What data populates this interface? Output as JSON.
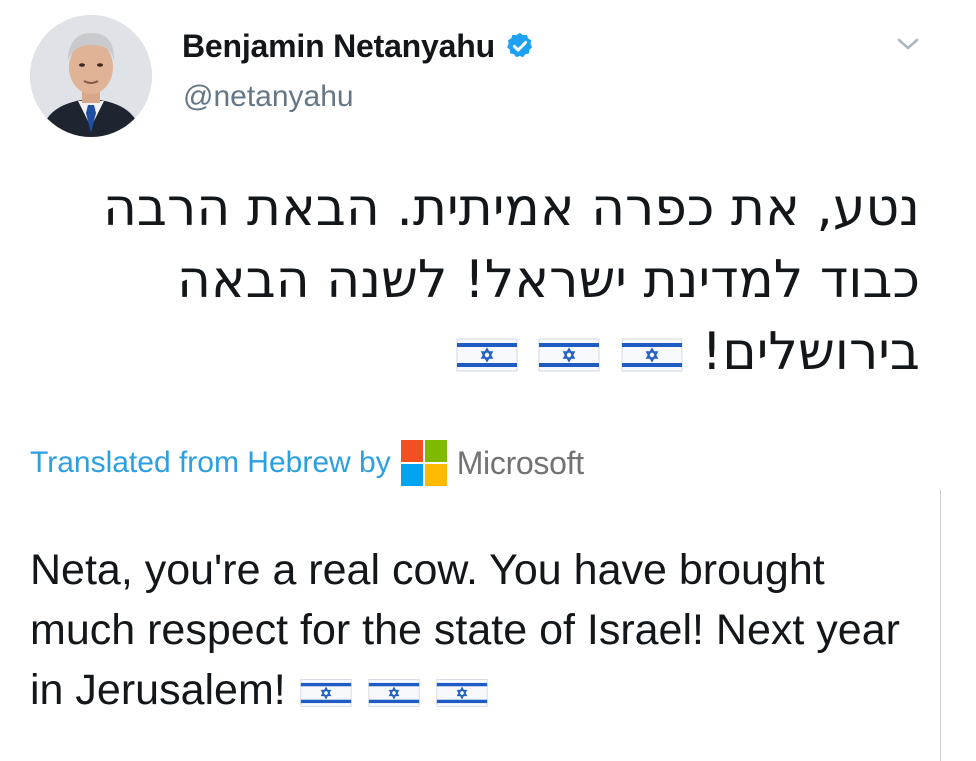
{
  "tweet": {
    "author": {
      "display_name": "Benjamin Netanyahu",
      "handle": "@netanyahu",
      "verified": true,
      "avatar_icon": "profile-photo"
    },
    "menu_icon": "chevron-down-icon",
    "original_text_lines": [
      "נטע, את כפרה אמיתית. הבאת הרבה",
      "כבוד למדינת ישראל! לשנה הבאה",
      "בירושלים!"
    ],
    "flag_emoji_count": 3,
    "translation": {
      "label": "Translated from Hebrew by",
      "provider": "Microsoft",
      "provider_colors": [
        "#f25022",
        "#7fba00",
        "#00a4ef",
        "#ffb900"
      ]
    },
    "translated_text": "Neta, you're a real cow. You have brought much respect for the state of Israel! Next year in Jerusalem!"
  },
  "colors": {
    "link_blue": "#2b9fe0",
    "verified_blue": "#1da1f2",
    "text": "#14171a",
    "secondary_text": "#657786"
  }
}
